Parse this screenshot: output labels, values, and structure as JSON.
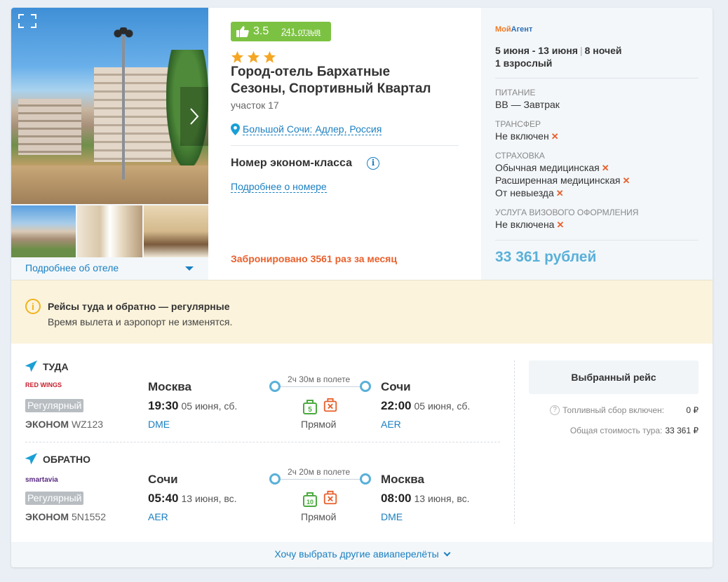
{
  "hotel": {
    "rating": "3.5",
    "reviews_label": "241 отзыв",
    "stars": 3,
    "name_line1": "Город-отель Бархатные",
    "name_line2": "Сезоны, Спортивный Квартал",
    "address": "участок 17",
    "location": "Большой Сочи: Адлер, Россия",
    "more_label": "Подробнее об отеле",
    "room_title": "Номер эконом-класса",
    "room_more_label": "Подробнее о номере",
    "booked_text": "Забронировано 3561 раз за месяц"
  },
  "summary": {
    "agent_logo_part1": "Мой",
    "agent_logo_part2": "Агент",
    "dates": "5 июня - 13 июня",
    "sep": "|",
    "nights": "8 ночей",
    "guests": "1 взрослый",
    "meal_label": "ПИТАНИЕ",
    "meal_value": "BB — Завтрак",
    "transfer_label": "ТРАНСФЕР",
    "transfer_value": "Не включен",
    "insurance_label": "СТРАХОВКА",
    "insurance_items": [
      "Обычная медицинская",
      "Расширенная медицинская",
      "От невыезда"
    ],
    "visa_label": "УСЛУГА ВИЗОВОГО ОФОРМЛЕНИЯ",
    "visa_value": "Не включена",
    "x_mark": "✕",
    "price": "33 361 рублей"
  },
  "notice": {
    "title": "Рейсы туда и обратно — регулярные",
    "text": "Время вылета и аэропорт не изменятся."
  },
  "flights": [
    {
      "leg": "ТУДА",
      "airline": "RED WINGS",
      "type": "Регулярный",
      "class_label": "ЭКОНОМ",
      "flight_no": "WZ123",
      "from_city": "Москва",
      "from_time": "19:30",
      "from_date": "05 июня, сб.",
      "from_code": "DME",
      "duration": "2ч 30м в полете",
      "baggage": "5",
      "direct": "Прямой",
      "to_city": "Сочи",
      "to_time": "22:00",
      "to_date": "05 июня, сб.",
      "to_code": "AER"
    },
    {
      "leg": "ОБРАТНО",
      "airline": "smartavia",
      "type": "Регулярный",
      "class_label": "ЭКОНОМ",
      "flight_no": "5N1552",
      "from_city": "Сочи",
      "from_time": "05:40",
      "from_date": "13 июня, вс.",
      "from_code": "AER",
      "duration": "2ч 20м в полете",
      "baggage": "10",
      "direct": "Прямой",
      "to_city": "Москва",
      "to_time": "08:00",
      "to_date": "13 июня, вс.",
      "to_code": "DME"
    }
  ],
  "selected": {
    "title": "Выбранный рейс",
    "fuel_label": "Топливный сбор включен:",
    "fuel_value": "0 ₽",
    "total_label": "Общая стоимость тура:",
    "total_value": "33 361 ₽"
  },
  "other_flights_label": "Хочу выбрать другие авиаперелёты",
  "colors": {
    "accent": "#1a7fc1",
    "rating_green": "#7cc242",
    "orange": "#e8602c",
    "price_blue": "#5ab0d8",
    "notice_bg": "#fbf3dc"
  }
}
